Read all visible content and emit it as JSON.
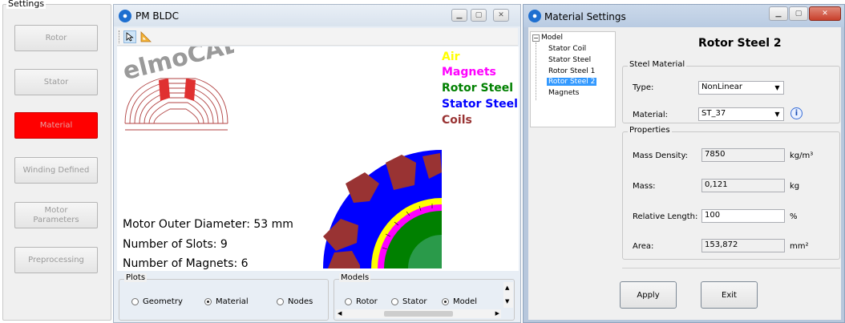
{
  "settings": {
    "legend": "Settings",
    "buttons": [
      {
        "label": "Rotor",
        "active": false
      },
      {
        "label": "Stator",
        "active": false
      },
      {
        "label": "Material",
        "active": true
      },
      {
        "label": "Winding Defined",
        "active": false
      },
      {
        "label": "Motor Parameters",
        "active": false
      },
      {
        "label": "Preprocessing",
        "active": false
      }
    ]
  },
  "pm_window": {
    "title": "PM BLDC",
    "logo_text": "elmoCAD",
    "info": {
      "outer_diameter": "Motor Outer Diameter: 53 mm",
      "slots": "Number of Slots: 9",
      "magnets": "Number of Magnets: 6"
    },
    "legend": [
      {
        "label": "Air",
        "color": "#ffff00"
      },
      {
        "label": "Magnets",
        "color": "#ff00ff"
      },
      {
        "label": "Rotor Steel",
        "color": "#008000"
      },
      {
        "label": "Stator Steel",
        "color": "#0000ff"
      },
      {
        "label": "Coils",
        "color": "#993333"
      }
    ],
    "plots": {
      "legend": "Plots",
      "options": [
        {
          "label": "Geometry",
          "selected": false
        },
        {
          "label": "Material",
          "selected": true
        },
        {
          "label": "Nodes",
          "selected": false
        }
      ]
    },
    "models": {
      "legend": "Models",
      "options": [
        {
          "label": "Rotor",
          "selected": false
        },
        {
          "label": "Stator",
          "selected": false
        },
        {
          "label": "Model",
          "selected": true
        }
      ]
    }
  },
  "material_window": {
    "title": "Material Settings",
    "tree": {
      "root": "Model",
      "items": [
        "Stator Coil",
        "Stator Steel",
        "Rotor Steel 1",
        "Rotor Steel 2",
        "Magnets"
      ],
      "selected": "Rotor Steel 2"
    },
    "heading": "Rotor Steel 2",
    "steel_material": {
      "legend": "Steel Material",
      "type_label": "Type:",
      "type_value": "NonLinear",
      "material_label": "Material:",
      "material_value": "ST_37"
    },
    "properties": {
      "legend": "Properties",
      "rows": [
        {
          "label": "Mass Density:",
          "value": "7850",
          "unit": "kg/m³"
        },
        {
          "label": "Mass:",
          "value": "0,121",
          "unit": "kg"
        },
        {
          "label": "Relative Length:",
          "value": "100",
          "unit": "%"
        },
        {
          "label": "Area:",
          "value": "153,872",
          "unit": "mm²"
        }
      ]
    },
    "apply_label": "Apply",
    "exit_label": "Exit"
  },
  "colors": {
    "stator_steel": "#0000ff",
    "coils": "#993333",
    "air": "#ffff00",
    "magnets": "#ff00ff",
    "rotor_steel": "#008000",
    "active_button": "#ff0000"
  }
}
